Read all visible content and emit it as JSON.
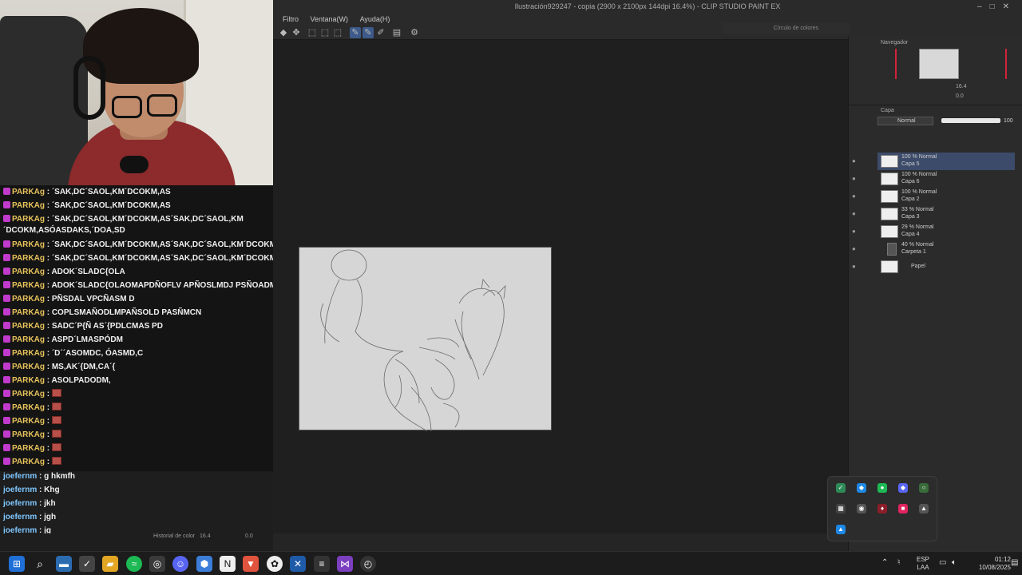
{
  "chat": {
    "messages": [
      {
        "user": "PARKAg",
        "text": "´SAK,DC´SAOL,KM´DCOKM,AS",
        "emote": false
      },
      {
        "user": "PARKAg",
        "text": "´SAK,DC´SAOL,KM´DCOKM,AS",
        "emote": false
      },
      {
        "user": "PARKAg",
        "text": "´SAK,DC´SAOL,KM´DCOKM,AS´SAK,DC´SAOL,KM ´DCOKM,ASÓASDAKS,´DOA,SD",
        "emote": false,
        "wrap": true
      },
      {
        "user": "PARKAg",
        "text": "´SAK,DC´SAOL,KM´DCOKM,AS´SAK,DC´SAOL,KM´DCOKM,AS",
        "emote": false
      },
      {
        "user": "PARKAg",
        "text": "´SAK,DC´SAOL,KM´DCOKM,AS´SAK,DC´SAOL,KM´DCOKM,AS",
        "emote": false
      },
      {
        "user": "PARKAg",
        "text": "ADOK´SLADC{OLA",
        "emote": false
      },
      {
        "user": "PARKAg",
        "text": "ADOK´SLADC{OLAOMAPDÑOFLV APÑOSLMDJ PSÑOADM C",
        "emote": false
      },
      {
        "user": "PARKAg",
        "text": "PÑSDAL VPCÑASM D",
        "emote": false
      },
      {
        "user": "PARKAg",
        "text": "COPLSMAÑODLMPAÑSOLD PASÑMCN",
        "emote": false
      },
      {
        "user": "PARKAg",
        "text": "SADC´P{Ñ AS´{PDLCMAS PD",
        "emote": false
      },
      {
        "user": "PARKAg",
        "text": "ASPD´LMASPÓDM",
        "emote": false
      },
      {
        "user": "PARKAg",
        "text": "´D´´ASOMDC, ÓASMD,C",
        "emote": false
      },
      {
        "user": "PARKAg",
        "text": "MS,AK´{DM,CA´{",
        "emote": false
      },
      {
        "user": "PARKAg",
        "text": "ASOLPADODM,",
        "emote": false
      },
      {
        "user": "PARKAg",
        "text": "",
        "emote": true
      },
      {
        "user": "PARKAg",
        "text": "",
        "emote": true
      },
      {
        "user": "PARKAg",
        "text": "",
        "emote": true
      },
      {
        "user": "PARKAg",
        "text": "",
        "emote": true
      },
      {
        "user": "PARKAg",
        "text": "",
        "emote": true
      },
      {
        "user": "PARKAg",
        "text": "",
        "emote": true
      }
    ],
    "messages2": [
      {
        "user": "joefernm",
        "text": "g hkmfh"
      },
      {
        "user": "joefernm",
        "text": "Khg"
      },
      {
        "user": "joefernm",
        "text": "jkh"
      },
      {
        "user": "joefernm",
        "text": "jgh"
      },
      {
        "user": "joefernm",
        "text": "jg"
      }
    ],
    "color_history_label": "Historial de color"
  },
  "app": {
    "title": "Ilustración929247 - copia (2900 x 2100px 144dpi 16.4%) - CLIP STUDIO PAINT EX",
    "menu": [
      "Filtro",
      "Ventana(W)",
      "Ayuda(H)"
    ],
    "color_circle_label": "Círculo de colores",
    "status_zoom": "16.4",
    "status_angle": "0.0"
  },
  "navigator": {
    "title": "Navegador",
    "zoom": "16.4",
    "rotation": "0.0"
  },
  "layers": {
    "title": "Capa",
    "blend_mode": "Normal",
    "opacity": "100",
    "items": [
      {
        "line1": "100 % Normal",
        "line2": "Capa 5",
        "selected": true
      },
      {
        "line1": "100 % Normal",
        "line2": "Capa 6",
        "selected": false
      },
      {
        "line1": "100 % Normal",
        "line2": "Capa 2",
        "selected": false
      },
      {
        "line1": "33 % Normal",
        "line2": "Capa 3",
        "selected": false
      },
      {
        "line1": "29 % Normal",
        "line2": "Capa 4",
        "selected": false
      },
      {
        "line1": "40 % Normal",
        "line2": "Carpeta 1",
        "selected": false,
        "folder": true
      },
      {
        "line1": "",
        "line2": "Papel",
        "selected": false,
        "paper": true
      }
    ]
  },
  "taskbar": {
    "language": "ESP",
    "language2": "LAA",
    "time": "01:12",
    "date": "10/08/2025"
  },
  "colors": {
    "chat_user": "#e7c35c",
    "chat_user2": "#7fc7ff",
    "badge": "#c03acb",
    "selected_layer": "#3c4b6a",
    "nav_marker": "#d2233a"
  }
}
